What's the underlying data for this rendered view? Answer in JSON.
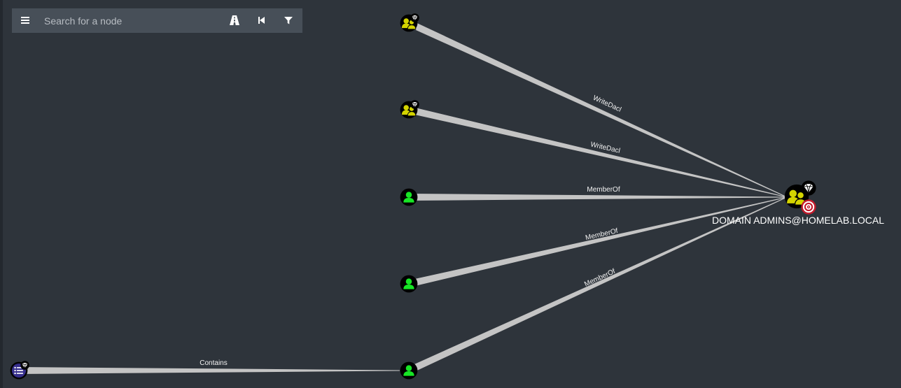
{
  "search": {
    "placeholder": "Search for a node"
  },
  "toolbar": {
    "menu_icon": "hamburger-menu-icon",
    "pathfinding_icon": "road-icon",
    "back_icon": "step-backward-icon",
    "filter_icon": "filter-icon"
  },
  "colors": {
    "background": "#2e343b",
    "toolbar": "#474f58",
    "group_node": "#d4d400",
    "user_node": "#17e625",
    "ou_node": "#352e8c",
    "edge": "#c4c4c4",
    "target_badge": "#c21b2c"
  },
  "graph": {
    "target_node": {
      "label": "DOMAIN ADMINS@HOMELAB.LOCAL",
      "type": "group",
      "high_value": true,
      "owned_target": true
    },
    "edges": [
      {
        "label": "WriteDacl",
        "source_type": "group",
        "high_value": true
      },
      {
        "label": "WriteDacl",
        "source_type": "group",
        "high_value": true
      },
      {
        "label": "MemberOf",
        "source_type": "user",
        "high_value": false
      },
      {
        "label": "MemberOf",
        "source_type": "user",
        "high_value": false
      },
      {
        "label": "MemberOf",
        "source_type": "user",
        "high_value": false
      },
      {
        "label": "Contains",
        "source_type": "ou",
        "high_value": true
      }
    ]
  }
}
